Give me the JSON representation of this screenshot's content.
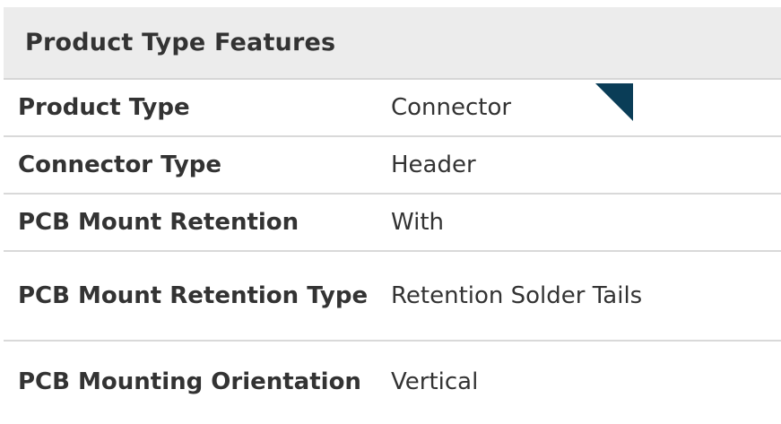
{
  "section": {
    "title": "Product Type Features"
  },
  "rows": [
    {
      "label": "Product Type",
      "value": "Connector"
    },
    {
      "label": "Connector Type",
      "value": "Header"
    },
    {
      "label": "PCB Mount Retention",
      "value": "With"
    },
    {
      "label": "PCB Mount Retention Type",
      "value": "Retention Solder Tails"
    },
    {
      "label": "PCB Mounting Orientation",
      "value": "Vertical"
    }
  ],
  "colors": {
    "header_bg": "#ececec",
    "text": "#333333",
    "divider": "#d9d9d9",
    "marker": "#0a3d57"
  },
  "icons": {
    "marker": "corner-triangle-icon"
  }
}
